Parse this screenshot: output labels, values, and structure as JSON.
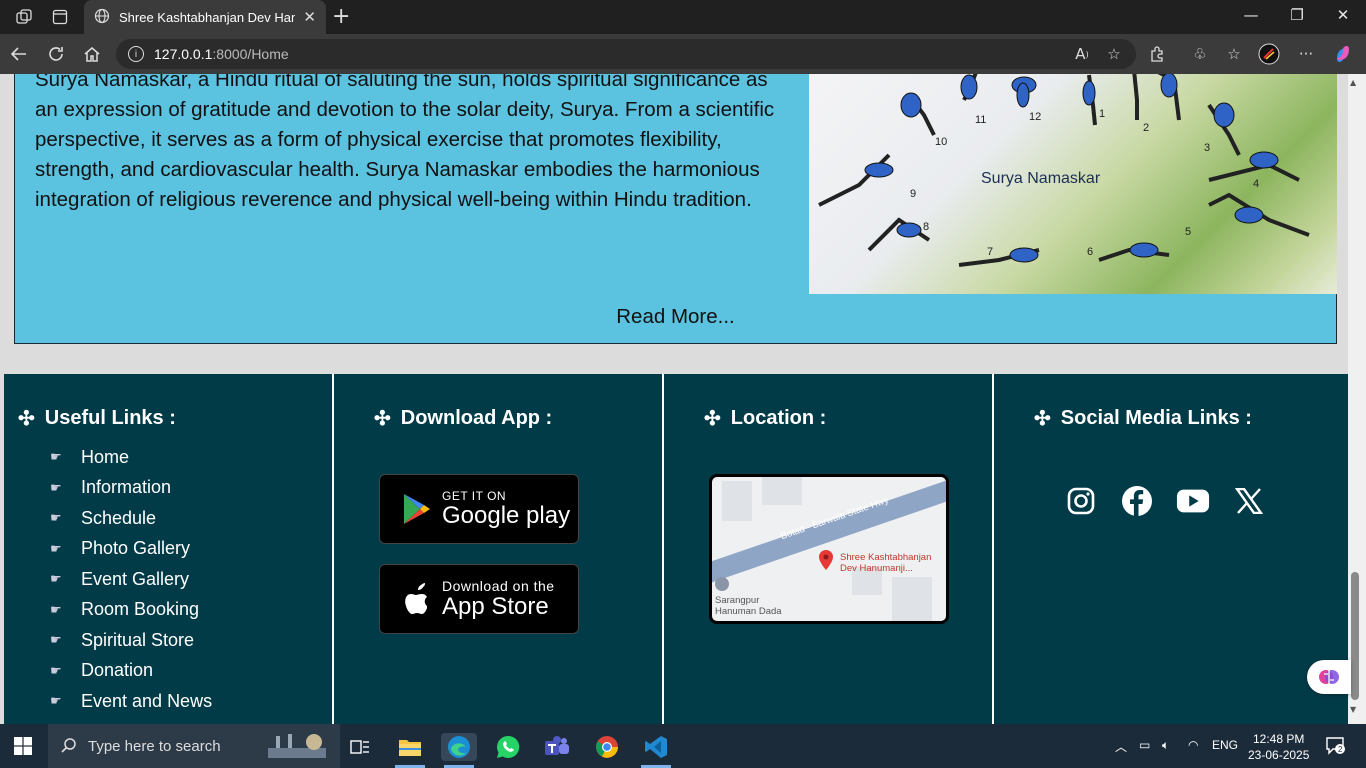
{
  "browser": {
    "tab_title": "Shree Kashtabhanjan Dev Hanum",
    "url_host": "127.0.0.1",
    "url_path": ":8000/Home"
  },
  "about": {
    "paragraph": "Surya Namaskar, a Hindu ritual of saluting the sun, holds spiritual significance as an expression of gratitude and devotion to the solar deity, Surya. From a scientific perspective, it serves as a form of physical exercise that promotes flexibility, strength, and cardiovascular health. Surya Namaskar embodies the harmonious integration of religious reverence and physical well-being within Hindu tradition.",
    "image_caption": "Surya Namaskar",
    "pose_numbers": [
      "1",
      "2",
      "3",
      "4",
      "5",
      "6",
      "7",
      "8",
      "9",
      "10",
      "11",
      "12"
    ],
    "read_more": "Read More..."
  },
  "footer": {
    "useful_links": {
      "heading": "Useful Links :",
      "items": [
        "Home",
        "Information",
        "Schedule",
        "Photo Gallery",
        "Event Gallery",
        "Room Booking",
        "Spiritual Store",
        "Donation",
        "Event and News"
      ]
    },
    "download_app": {
      "heading": "Download App :",
      "google_small": "GET IT ON",
      "google_big": "Google play",
      "apple_small": "Download on the",
      "apple_big": "App Store"
    },
    "location": {
      "heading": "Location :",
      "road_label": "Botad - Barwala State Hwy",
      "pin_label_1": "Shree Kashtabhanjan",
      "pin_label_2": "Dev Hanumanji...",
      "place_label_1": "Sarangpur",
      "place_label_2": "Hanuman Dada"
    },
    "social": {
      "heading": "Social Media Links :",
      "icons": [
        "instagram-icon",
        "facebook-icon",
        "youtube-icon",
        "x-icon"
      ]
    }
  },
  "taskbar": {
    "search_placeholder": "Type here to search",
    "language": "ENG",
    "time": "12:48 PM",
    "date": "23-06-2025"
  },
  "colors": {
    "about_bg": "#5bc2e0",
    "footer_bg": "#023b48",
    "page_bg": "#dcdcdc"
  }
}
